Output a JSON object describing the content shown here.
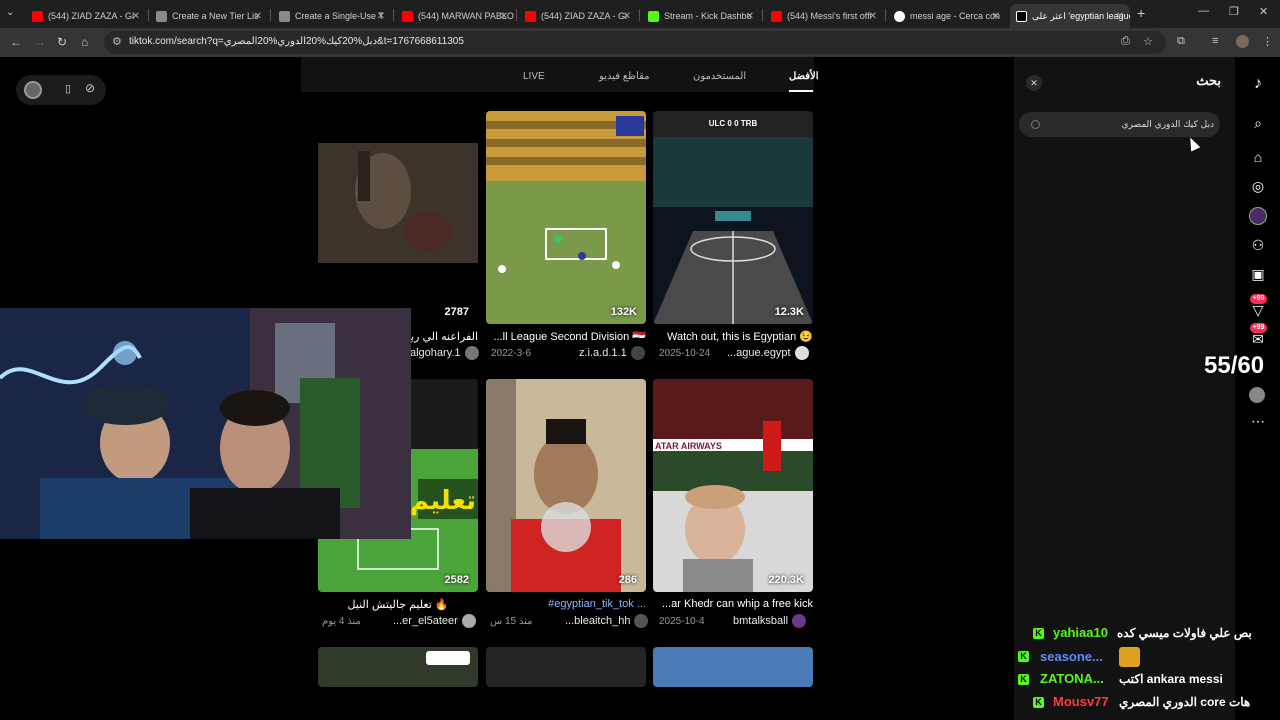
{
  "browser": {
    "tabs": [
      {
        "title": "(544) ZIAD ZAZA - Gi",
        "icon": "youtube-icon",
        "color": "#ff0000"
      },
      {
        "title": "Create a New Tier Lis",
        "icon": "document-icon",
        "color": "#aaaaaa"
      },
      {
        "title": "Create a Single-Use T",
        "icon": "document-icon",
        "color": "#aaaaaa"
      },
      {
        "title": "(544) MARWAN PABLO",
        "icon": "youtube-icon",
        "color": "#ff0000"
      },
      {
        "title": "(544) ZIAD ZAZA - Gi",
        "icon": "youtube-icon",
        "color": "#ff0000"
      },
      {
        "title": "Stream - Kick Dashbo",
        "icon": "kick-icon",
        "color": "#53fc18"
      },
      {
        "title": "(544) Messi's first offi",
        "icon": "youtube-icon",
        "color": "#ff0000"
      },
      {
        "title": "messi age - Cerca con",
        "icon": "google-icon",
        "color": "#ffffff"
      },
      {
        "title": "اعثر على 'egyptian league",
        "icon": "tiktok-icon",
        "color": "#ffffff"
      }
    ],
    "url": "tiktok.com/search?q=دبل%20كيك%20الدوري%20المصري&t=1767668611305"
  },
  "filter_tabs": [
    {
      "label": "الأفضل",
      "active": true
    },
    {
      "label": "المستخدمون",
      "active": false
    },
    {
      "label": "مقاطع فيديو",
      "active": false
    },
    {
      "label": "LIVE",
      "active": false
    }
  ],
  "videos": [
    {
      "count": "2787",
      "caption": "الفراعنه الي ربع النهائي",
      "date": "",
      "author": "algohary.1"
    },
    {
      "count": "132K",
      "caption": "...ll League Second Division 🇪🇬",
      "date": "2022-3-6",
      "author": "z.i.a.d.1.1"
    },
    {
      "count": "12.3K",
      "caption": "Watch out, this is Egyptian 😉",
      "date": "2025-10-24",
      "author": "...ague.egypt"
    },
    {
      "count": "2582",
      "caption": "تعليم جاليتش النيل 🔥",
      "date": "منذ 4 يوم",
      "author": "...er_el5ateer"
    },
    {
      "count": "286",
      "caption": "#egyptian_tik_tok ...",
      "date": "منذ 15 س",
      "author": "...bleaitch_hh"
    },
    {
      "count": "220.3K",
      "caption": "...ar Khedr can whip a free kick",
      "date": "2025-10-4",
      "author": "bmtalksball"
    }
  ],
  "search_panel": {
    "title": "بحث",
    "query": "دبل كيك الدوري المصري"
  },
  "sidebar": {
    "badge1": "+99",
    "badge2": "+99"
  },
  "overlay": {
    "counter": "55/60"
  },
  "chat": [
    {
      "user": "yahiaa10",
      "message": "بص علي فاولات ميسي كده",
      "color": "#53fc18"
    },
    {
      "user": "seasone...",
      "message": "",
      "color": "#5b8cff"
    },
    {
      "user": "ZATONA...",
      "message": "اكتب ankara messi",
      "color": "#53fc18"
    },
    {
      "user": "Mousv77",
      "message": "الدوري المصري core هات",
      "color": "#ff3b3b"
    }
  ],
  "video_thumb_text": {
    "scoreboard": "ULC 0 0 TRB",
    "qatar_banner": "ATAR AIRWAYS",
    "teach_text": "تعليم ا"
  }
}
